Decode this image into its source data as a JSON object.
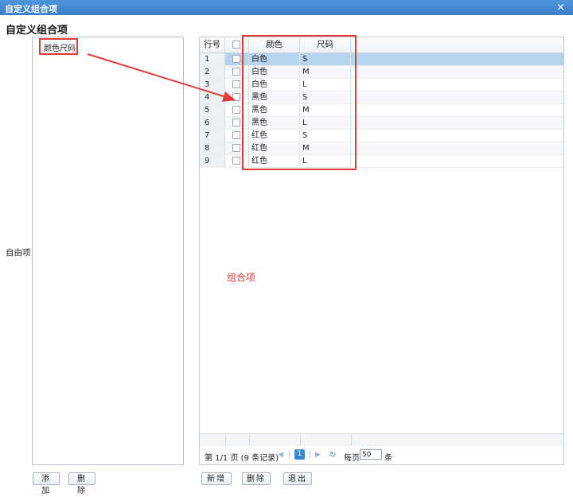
{
  "window": {
    "title": "自定义组合项",
    "close_glyph": "×"
  },
  "heading": "自定义组合项",
  "free_panel": {
    "label": "自由项",
    "items": [
      "颜色尺码"
    ]
  },
  "grid": {
    "headers": {
      "row_num": "行号",
      "color": "颜色",
      "size": "尺码"
    },
    "rows": [
      {
        "num": "1",
        "color": "白色",
        "size": "S",
        "selected": true
      },
      {
        "num": "2",
        "color": "白色",
        "size": "M"
      },
      {
        "num": "3",
        "color": "白色",
        "size": "L"
      },
      {
        "num": "4",
        "color": "黑色",
        "size": "S"
      },
      {
        "num": "5",
        "color": "黑色",
        "size": "M"
      },
      {
        "num": "6",
        "color": "黑色",
        "size": "L"
      },
      {
        "num": "7",
        "color": "红色",
        "size": "S"
      },
      {
        "num": "8",
        "color": "红色",
        "size": "M"
      },
      {
        "num": "9",
        "color": "红色",
        "size": "L"
      }
    ]
  },
  "combo_label": "组合项",
  "pager": {
    "page_text": "第 1/1 页 (9 条记录)",
    "current_page": "1",
    "per_page_label": "每页",
    "per_page_value": "50",
    "per_page_unit": "条"
  },
  "buttons": {
    "add": "添加",
    "delete_left": "删除",
    "new": "新增",
    "delete_right": "删除",
    "exit": "退出"
  },
  "colors": {
    "annotation_red": "#e03a3a",
    "title_bar": "#3f87d2",
    "selected_row": "#b7d4ef"
  },
  "icons": {
    "first_page": "first-page-icon",
    "prev_page": "prev-page-icon",
    "next_page": "next-page-icon",
    "last_page": "last-page-icon",
    "refresh": "refresh-icon"
  }
}
